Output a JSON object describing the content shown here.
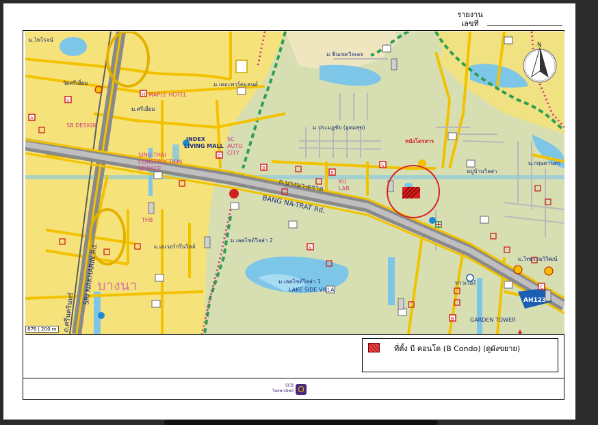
{
  "header": {
    "report_label": "รายงาน\nเลขที่"
  },
  "map": {
    "roads": {
      "bangna_trat_th": "ถ.บางนา-ตราด",
      "bangna_trat_en": "BANG NA-TRAT Rd.",
      "sri_nakharin_en": "SRI NAKHARIN Rd.",
      "sri_nakharin_th": "ถ.ศรีนครินทร์",
      "highway": "AH123"
    },
    "area_name": "บางนา",
    "labels": [
      "ม.ไพโรจน์",
      "วัดศรีเอี่ยม",
      "MAPLE HOTEL",
      "SB DESIGN",
      "INDEX LIVING MALL",
      "SC AUTO CITY",
      "SINO-THAI CONSTRUCTION SERVICE",
      "ม.ศรีเอี่ยม",
      "ม.เดอะพาร์คแลนด์",
      "ม.ชินเขตวิลเลจ",
      "ม.ประมฎชัย (อุดมสุข)",
      "หมู่บ้านวิลล่า",
      "LAKE SIDE VILLA",
      "ม.เลคไซด์วิลล่า 1",
      "ม.เลคไซด์วิลล่า 2",
      "GARDEN TOWER",
      "THB",
      "KU LAB",
      "ม.เอเวอร์กรีนวิลล์",
      "ทาวเวอร์",
      "บางนา",
      "ม.ไทยร่วมวิวิฒน์",
      "ม.กฤษดานคร"
    ],
    "scale_text": "876  |  200 m",
    "compass": "N"
  },
  "legend": {
    "swatch_color": "#e03a3a",
    "text": "ที่ตั้ง บี คอนโด (B Condo) (ดูผังขยาย)"
  },
  "footer": {
    "logo_text": "SCB\nไทยพาณิชย์",
    "logo_color": "#4b2a7d"
  },
  "colors": {
    "yellow_zone": "#f5e27a",
    "green_zone": "#d7dfb2",
    "water": "#7ec6e8",
    "road_gray": "#9a9a9a",
    "road_yellow": "#f2c200",
    "boundary_green": "#2e9e52",
    "boundary_pink": "#d23a7a",
    "marker_red": "#d82020"
  }
}
